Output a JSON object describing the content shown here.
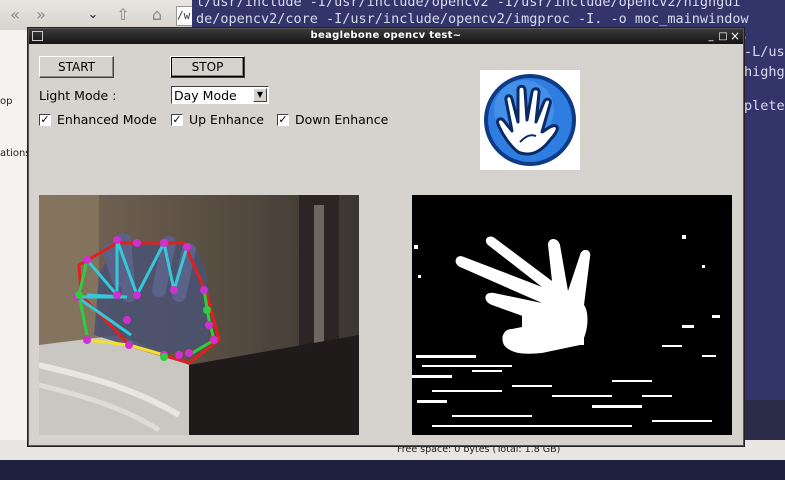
{
  "window": {
    "title": "beaglebone opencv test~",
    "controls": {
      "minimize": "_",
      "maximize": "□",
      "close": "×"
    }
  },
  "controls": {
    "start_label": "START",
    "stop_label": "STOP",
    "light_mode_label": "Light Mode :",
    "light_mode_value": "Day Mode",
    "checkboxes": [
      {
        "label": "Enhanced Mode",
        "checked": true
      },
      {
        "label": "Up Enhance",
        "checked": true
      },
      {
        "label": "Down Enhance",
        "checked": true
      }
    ],
    "check_mark": "✓"
  },
  "logo": {
    "icon": "hand-icon",
    "colors": {
      "ring": "#1b4fa8",
      "fill": "#2e7de0",
      "hand": "#ffffff"
    }
  },
  "video": {
    "left": "camera-feed-annotated",
    "right": "binary-mask-feed"
  },
  "background": {
    "file_manager": {
      "path_field": "/w",
      "side_labels": [
        "op",
        "ations"
      ]
    },
    "terminal_lines": [
      "l/usr/include -I/usr/include/opencv2 -I/usr/include/opencv2/highgui",
      "de/opencv2/core -I/usr/include/opencv2/imgproc -I. -o moc_mainwindow",
      "~",
      "-L/us",
      "highg",
      "",
      "plete"
    ],
    "status_text": "Free space: 0 bytes (Total: 1.8 GB)"
  },
  "colors": {
    "window_bg": "#d6d3ce",
    "titlebar": "#1a1a1a",
    "terminal_bg": "#33346a"
  }
}
